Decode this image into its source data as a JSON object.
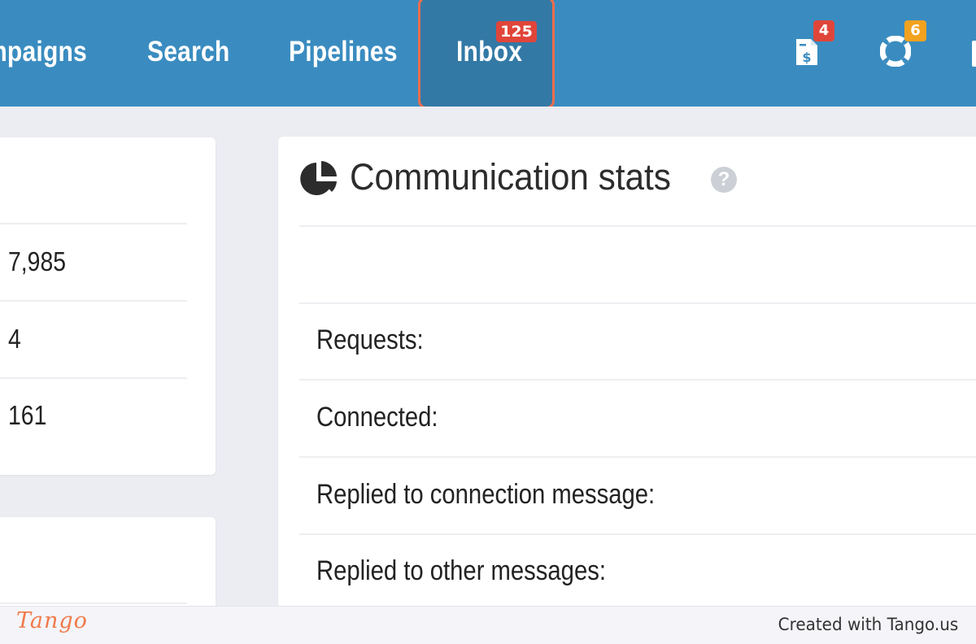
{
  "nav": {
    "items": [
      {
        "label": "mpaigns"
      },
      {
        "label": "Search"
      },
      {
        "label": "Pipelines"
      },
      {
        "label": "Inbox",
        "badge": "125"
      }
    ],
    "invoice_badge": "4",
    "help_badge": "6",
    "icons": [
      "invoice-icon",
      "lifebuoy-icon"
    ]
  },
  "left_card": {
    "values": [
      "7,985",
      "4",
      "161"
    ]
  },
  "stats_card": {
    "title": "Communication stats",
    "help_symbol": "?",
    "rows": [
      {
        "label": "Requests:"
      },
      {
        "label": "Connected:"
      },
      {
        "label": "Replied to connection message:"
      },
      {
        "label": "Replied to other messages:"
      }
    ]
  },
  "footer": {
    "logo": "Tango",
    "credit": "Created with Tango.us"
  },
  "colors": {
    "nav_bg": "#3a8cc0",
    "highlight_border": "#f06d4b",
    "badge_red": "#e0453a",
    "badge_orange": "#f3a21f"
  }
}
